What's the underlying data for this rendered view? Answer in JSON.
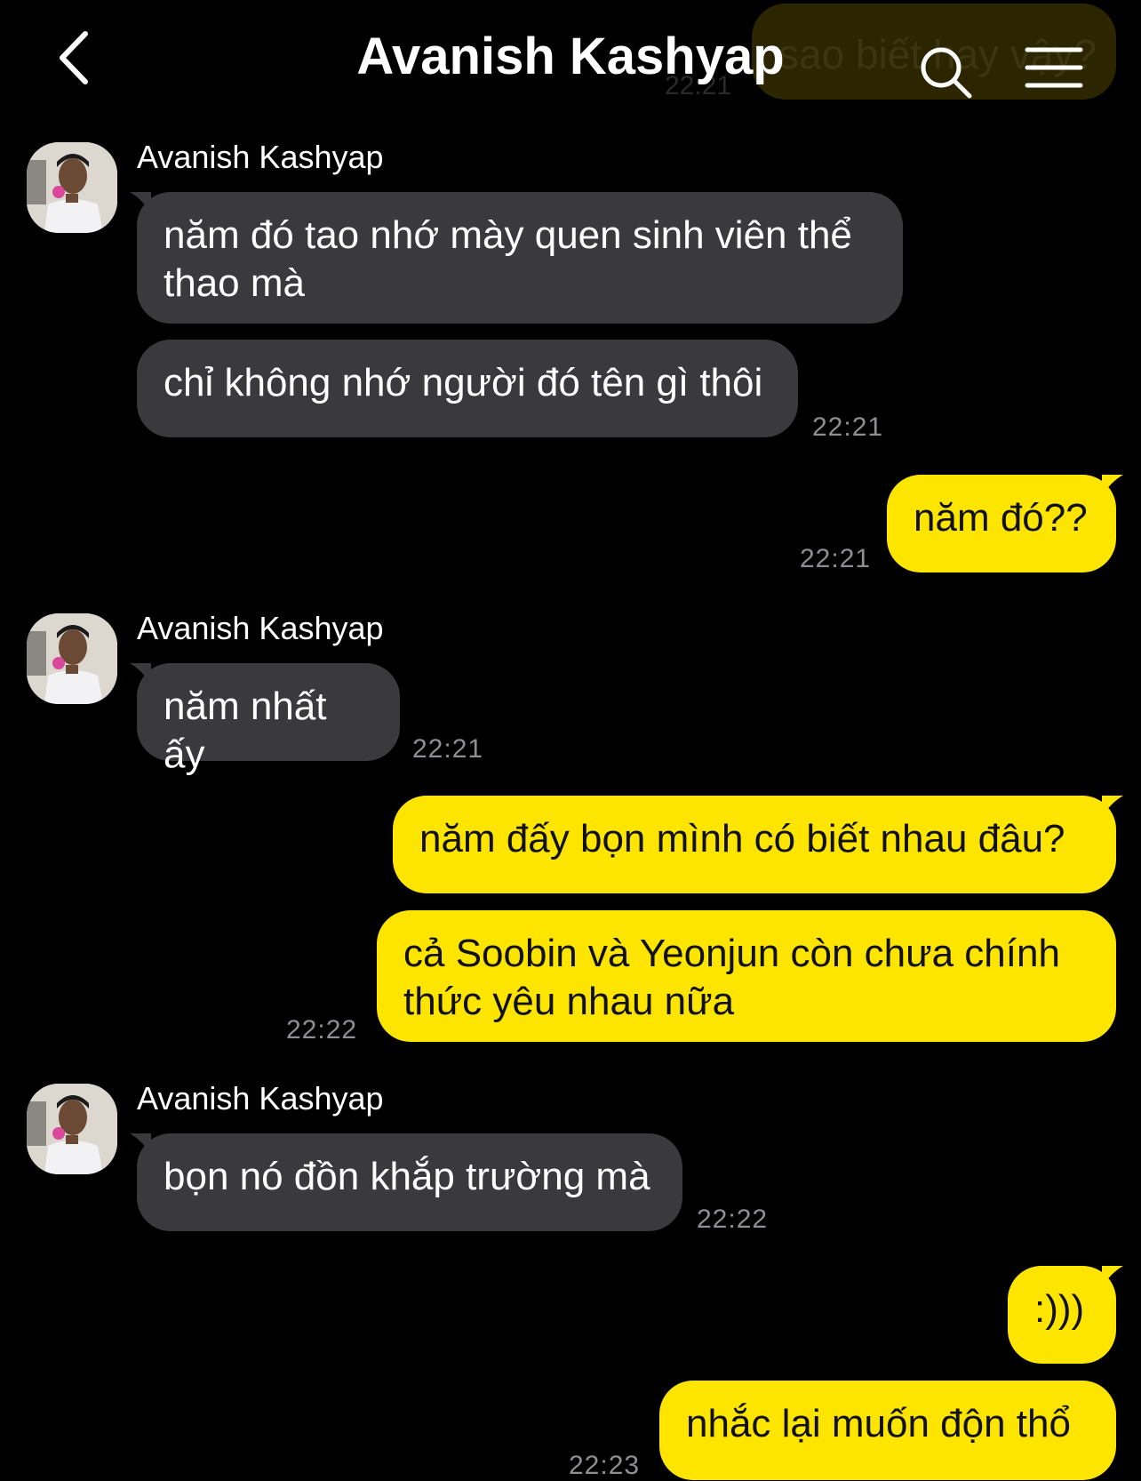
{
  "header": {
    "title": "Avanish Kashyap",
    "back_icon": "chevron-left-icon",
    "search_icon": "search-icon",
    "menu_icon": "hamburger-menu-icon"
  },
  "ghost": {
    "text": "sao biết hay vậy?",
    "time": "22:21"
  },
  "colors": {
    "incoming_bubble": "#3a3a3c",
    "outgoing_bubble": "#fee500",
    "background": "#000000",
    "timestamp": "#8e8e93"
  },
  "messages": [
    {
      "sender": "Avanish Kashyap",
      "line1": "năm đó tao nhớ mày quen sinh viên thể",
      "line2": "thao mà"
    },
    {
      "text": "chỉ không nhớ người đó tên gì thôi",
      "time": "22:21"
    },
    {
      "text": "năm đó??",
      "time": "22:21"
    },
    {
      "sender": "Avanish Kashyap",
      "text": "năm nhất ấy",
      "time": "22:21"
    },
    {
      "text": "năm đấy bọn mình có biết nhau đâu?"
    },
    {
      "line1": "cả Soobin và Yeonjun còn chưa chính",
      "line2": "thức yêu nhau nữa",
      "time": "22:22"
    },
    {
      "sender": "Avanish Kashyap",
      "text": "bọn nó đồn khắp trường mà",
      "time": "22:22"
    },
    {
      "text": ":)))"
    },
    {
      "text": "nhắc lại muốn độn thổ",
      "time": "22:23"
    }
  ]
}
